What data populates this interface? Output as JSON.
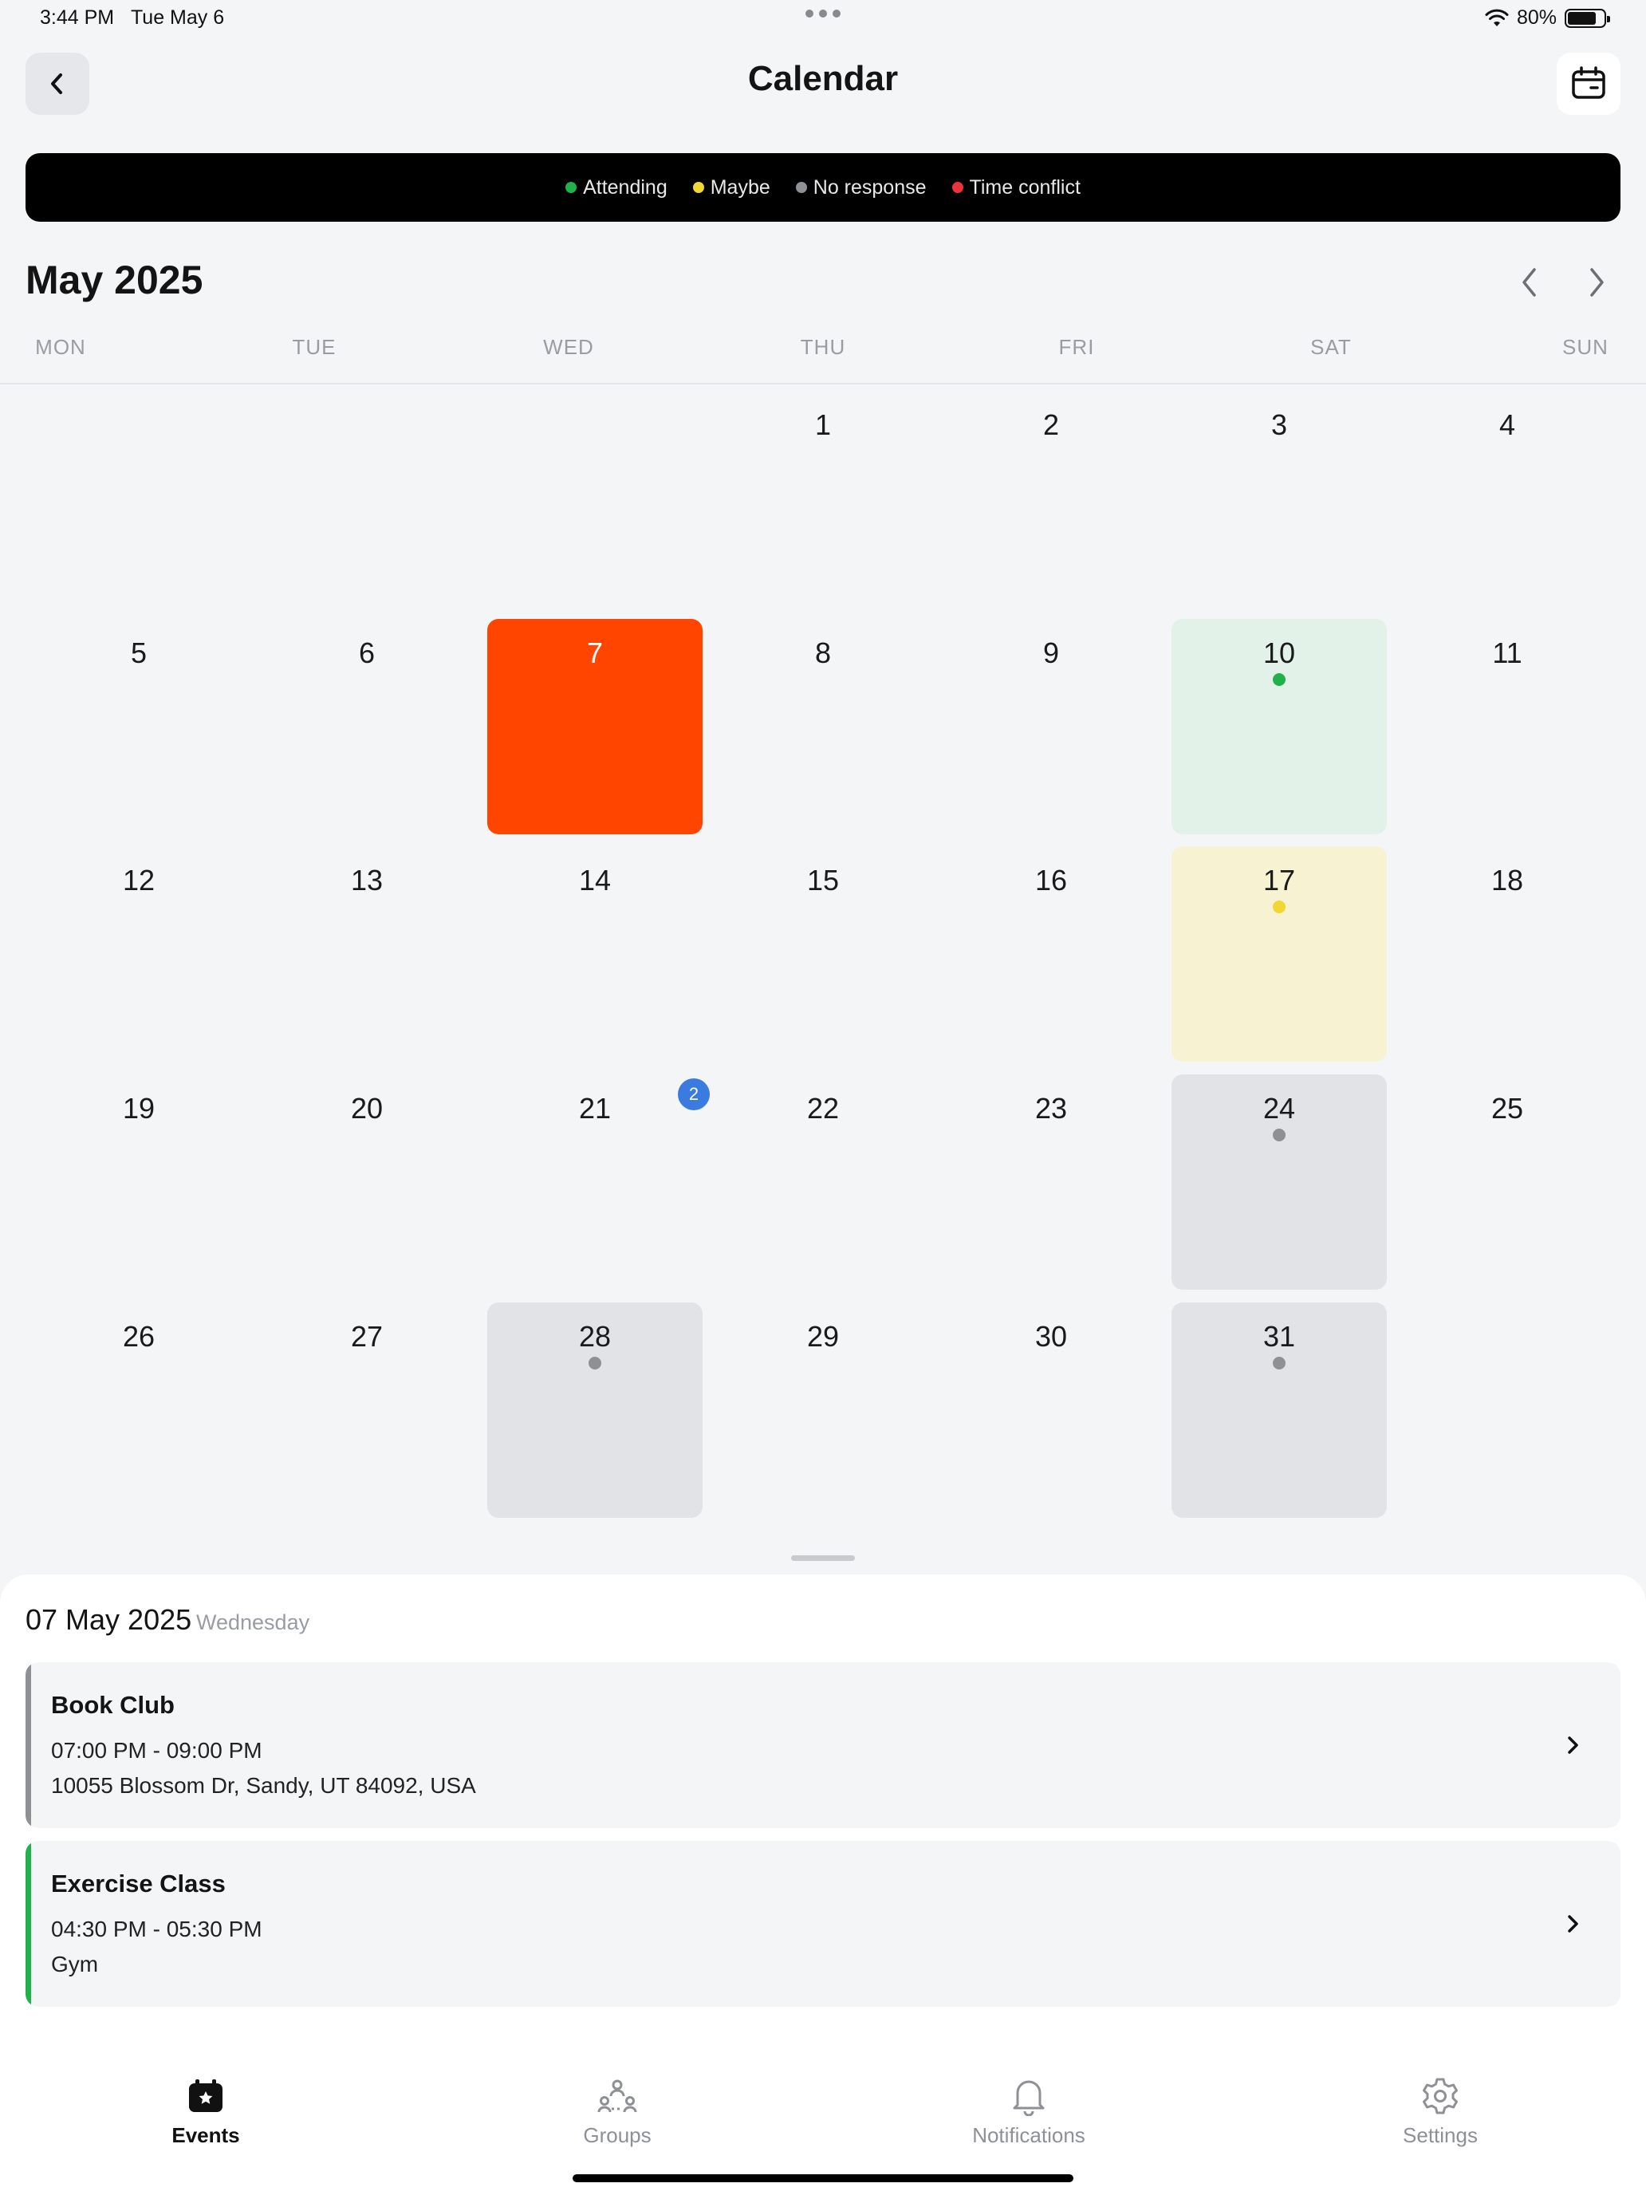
{
  "status_bar": {
    "time": "3:44 PM",
    "date": "Tue May 6",
    "battery": "80%",
    "battery_level": 0.8
  },
  "header": {
    "title": "Calendar",
    "back_icon": "chevron-left-icon",
    "calendar_icon": "calendar-icon"
  },
  "legend": [
    {
      "label": "Attending",
      "color": "#22b04b"
    },
    {
      "label": "Maybe",
      "color": "#f2d633"
    },
    {
      "label": "No response",
      "color": "#8e9096"
    },
    {
      "label": "Time conflict",
      "color": "#e8343a"
    }
  ],
  "month": {
    "title": "May 2025"
  },
  "weekdays": [
    "MON",
    "TUE",
    "WED",
    "THU",
    "FRI",
    "SAT",
    "SUN"
  ],
  "days": [
    {
      "day": "1",
      "col": 3,
      "row": 0
    },
    {
      "day": "2",
      "col": 4,
      "row": 0
    },
    {
      "day": "3",
      "col": 5,
      "row": 0
    },
    {
      "day": "4",
      "col": 6,
      "row": 0
    },
    {
      "day": "5",
      "col": 0,
      "row": 1
    },
    {
      "day": "6",
      "col": 1,
      "row": 1
    },
    {
      "day": "7",
      "col": 2,
      "row": 1,
      "state": "selected"
    },
    {
      "day": "8",
      "col": 3,
      "row": 1
    },
    {
      "day": "9",
      "col": 4,
      "row": 1
    },
    {
      "day": "10",
      "col": 5,
      "row": 1,
      "state": "attending"
    },
    {
      "day": "11",
      "col": 6,
      "row": 1
    },
    {
      "day": "12",
      "col": 0,
      "row": 2
    },
    {
      "day": "13",
      "col": 1,
      "row": 2
    },
    {
      "day": "14",
      "col": 2,
      "row": 2
    },
    {
      "day": "15",
      "col": 3,
      "row": 2
    },
    {
      "day": "16",
      "col": 4,
      "row": 2
    },
    {
      "day": "17",
      "col": 5,
      "row": 2,
      "state": "maybe"
    },
    {
      "day": "18",
      "col": 6,
      "row": 2
    },
    {
      "day": "19",
      "col": 0,
      "row": 3
    },
    {
      "day": "20",
      "col": 1,
      "row": 3
    },
    {
      "day": "21",
      "col": 2,
      "row": 3,
      "badge": "2"
    },
    {
      "day": "22",
      "col": 3,
      "row": 3
    },
    {
      "day": "23",
      "col": 4,
      "row": 3
    },
    {
      "day": "24",
      "col": 5,
      "row": 3,
      "state": "noresp"
    },
    {
      "day": "25",
      "col": 6,
      "row": 3
    },
    {
      "day": "26",
      "col": 0,
      "row": 4
    },
    {
      "day": "27",
      "col": 1,
      "row": 4
    },
    {
      "day": "28",
      "col": 2,
      "row": 4,
      "state": "noresp"
    },
    {
      "day": "29",
      "col": 3,
      "row": 4
    },
    {
      "day": "30",
      "col": 4,
      "row": 4
    },
    {
      "day": "31",
      "col": 5,
      "row": 4,
      "state": "noresp"
    }
  ],
  "selected_day": {
    "date": "07 May 2025",
    "weekday": "Wednesday",
    "events": [
      {
        "title": "Book Club",
        "time": "07:00 PM - 09:00 PM",
        "location": "10055 Blossom Dr, Sandy, UT 84092, USA",
        "status_color": "#8e9096"
      },
      {
        "title": "Exercise Class",
        "time": "04:30 PM - 05:30 PM",
        "location": "Gym",
        "status_color": "#22b04b"
      }
    ]
  },
  "tabs": [
    {
      "label": "Events",
      "icon": "events-icon",
      "active": true
    },
    {
      "label": "Groups",
      "icon": "groups-icon",
      "active": false
    },
    {
      "label": "Notifications",
      "icon": "bell-icon",
      "active": false
    },
    {
      "label": "Settings",
      "icon": "gear-icon",
      "active": false
    }
  ]
}
